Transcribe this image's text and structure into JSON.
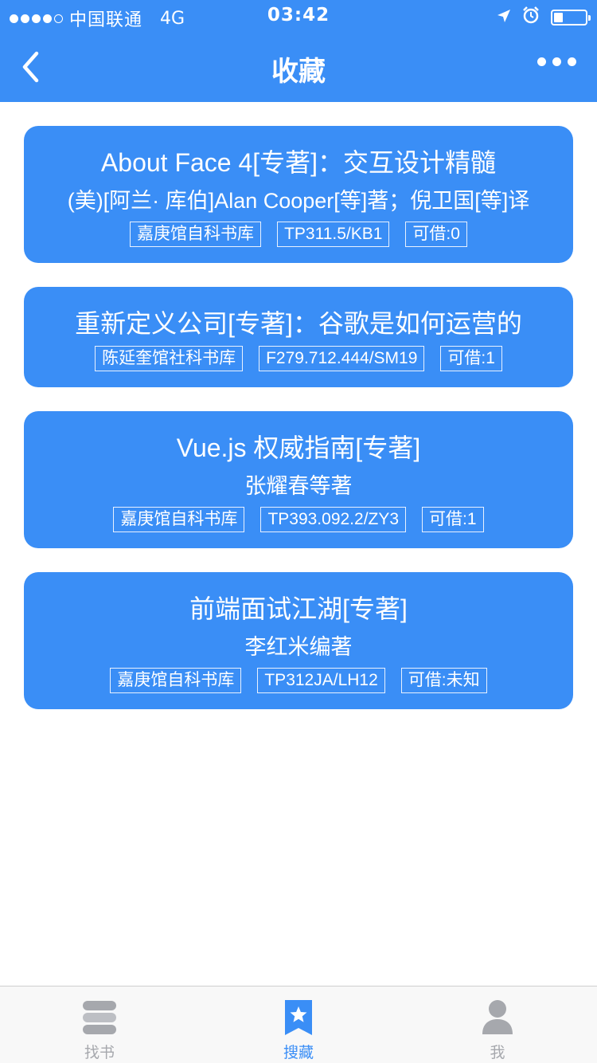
{
  "status_bar": {
    "carrier": "中国联通",
    "network": "4G",
    "time": "03:42",
    "battery_level": 0.3
  },
  "nav": {
    "title": "收藏",
    "back_icon": "chevron-left-icon",
    "more_icon": "more-dots-icon"
  },
  "books": [
    {
      "title": "About Face 4[专著]：交互设计精髓",
      "author": "(美)[阿兰· 库伯]Alan Cooper[等]著；倪卫国[等]译",
      "library": "嘉庚馆自科书库",
      "call_number": "TP311.5/KB1",
      "availability": "可借:0"
    },
    {
      "title": "重新定义公司[专著]：谷歌是如何运营的",
      "author": "",
      "library": "陈延奎馆社科书库",
      "call_number": "F279.712.444/SM19",
      "availability": "可借:1"
    },
    {
      "title": "Vue.js 权威指南[专著]",
      "author": "张耀春等著",
      "library": "嘉庚馆自科书库",
      "call_number": "TP393.092.2/ZY3",
      "availability": "可借:1"
    },
    {
      "title": "前端面试江湖[专著]",
      "author": "李红米编著",
      "library": "嘉庚馆自科书库",
      "call_number": "TP312JA/LH12",
      "availability": "可借:未知"
    }
  ],
  "tabbar": {
    "items": [
      {
        "label": "找书",
        "icon": "books-icon",
        "active": false
      },
      {
        "label": "搜藏",
        "icon": "bookmark-star-icon",
        "active": true
      },
      {
        "label": "我",
        "icon": "user-icon",
        "active": false
      }
    ]
  },
  "colors": {
    "accent": "#3a8ef6",
    "tab_inactive": "#a6a8ad"
  }
}
